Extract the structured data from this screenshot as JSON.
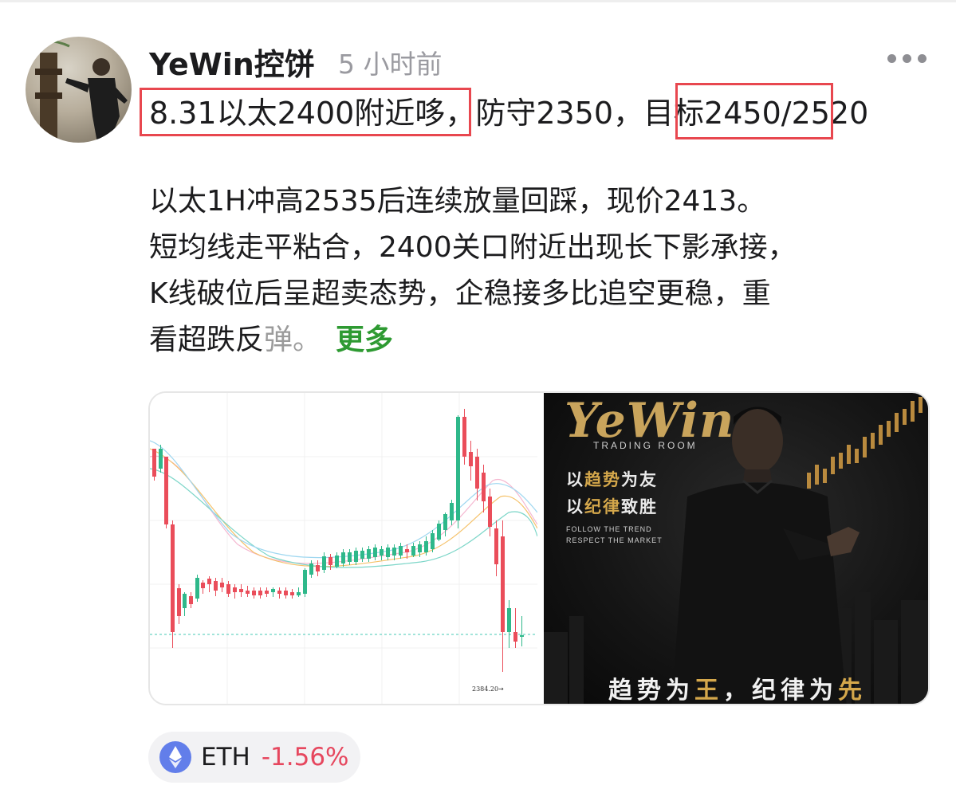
{
  "post": {
    "username": "YeWin控饼",
    "time": "5 小时前",
    "headline": {
      "part1": "8.31以太2400附近哆",
      "part2": "，防守2350，",
      "part3": "目标2450",
      "part4": "/2520"
    },
    "body_lines": [
      "以太1H冲高2535后连续放量回踩，现价2413。",
      "短均线走平粘合，2400关口附近出现长下影承接，",
      "K线破位后呈超卖态势，企稳接多比追空更稳，重"
    ],
    "last_line_main": "看超跌反",
    "last_line_fade": "弹。",
    "more_label": "更多"
  },
  "images": {
    "chart_price_label": "2384.20",
    "poster": {
      "logo": "YeWin",
      "subtitle": "TRADING ROOM",
      "slogan1_a": "以",
      "slogan1_b": "趋势",
      "slogan1_c": "为友",
      "slogan2_a": "以",
      "slogan2_b": "纪律",
      "slogan2_c": "致胜",
      "en1": "FOLLOW THE TREND",
      "en2": "RESPECT THE MARKET",
      "bottom_a": "趋势为",
      "bottom_b": "王",
      "bottom_c": "，纪律为",
      "bottom_d": "先"
    }
  },
  "coin_tag": {
    "icon": "ethereum-icon",
    "symbol": "ETH",
    "change": "-1.56%",
    "change_color": "#e6475e"
  },
  "colors": {
    "highlight_box": "#e8474f",
    "more_link": "#2e9a32",
    "candle_up": "#2eb88a",
    "candle_down": "#ea4d5a",
    "poster_gold": "#d4a74b"
  }
}
